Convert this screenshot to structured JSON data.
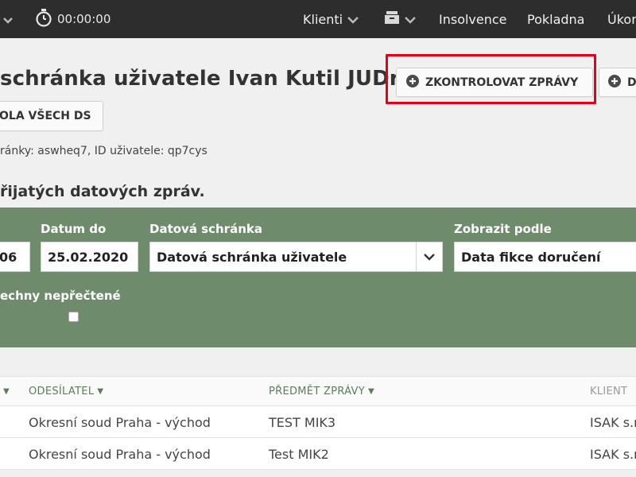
{
  "topbar": {
    "timer": "00:00:00",
    "nav": {
      "clients": "Klienti",
      "insolvency": "Insolvence",
      "cashbox": "Pokladna",
      "tasks": "Úkon"
    }
  },
  "header": {
    "title": "schránka uživatele Ivan Kutil JUDr.",
    "check_button": "ZKONTROLOVAT ZPRÁVY",
    "next_button": "D",
    "all_button": "OLA VŠECH DS",
    "meta": "ránky: aswheq7, ID uživatele: qp7cys"
  },
  "section_title": "řijatých datových zpráv.",
  "filters": {
    "date_from_value": "06",
    "date_to_label": "Datum do",
    "date_to_value": "25.02.2020",
    "box_label": "Datová schránka",
    "box_value": "Datová schránka uživatele",
    "display_label": "Zobrazit podle",
    "display_value": "Data fikce doručení",
    "unread_label": "echny nepřečtené"
  },
  "table": {
    "columns": {
      "sender": "ODESÍLATEL",
      "subject": "PŘEDMĚT ZPRÁVY",
      "client": "KLIENT"
    },
    "rows": [
      {
        "sender": "Okresní soud Praha - východ",
        "subject": "TEST MIK3",
        "client": "ISAK s.r"
      },
      {
        "sender": "Okresní soud Praha - východ",
        "subject": "Test MIK2",
        "client": "ISAK s.r"
      }
    ]
  },
  "colors": {
    "topbar": "#2d2d2d",
    "filter_panel": "#6e8c6c",
    "highlight": "#e3001b",
    "header_link": "#5a7e58"
  }
}
